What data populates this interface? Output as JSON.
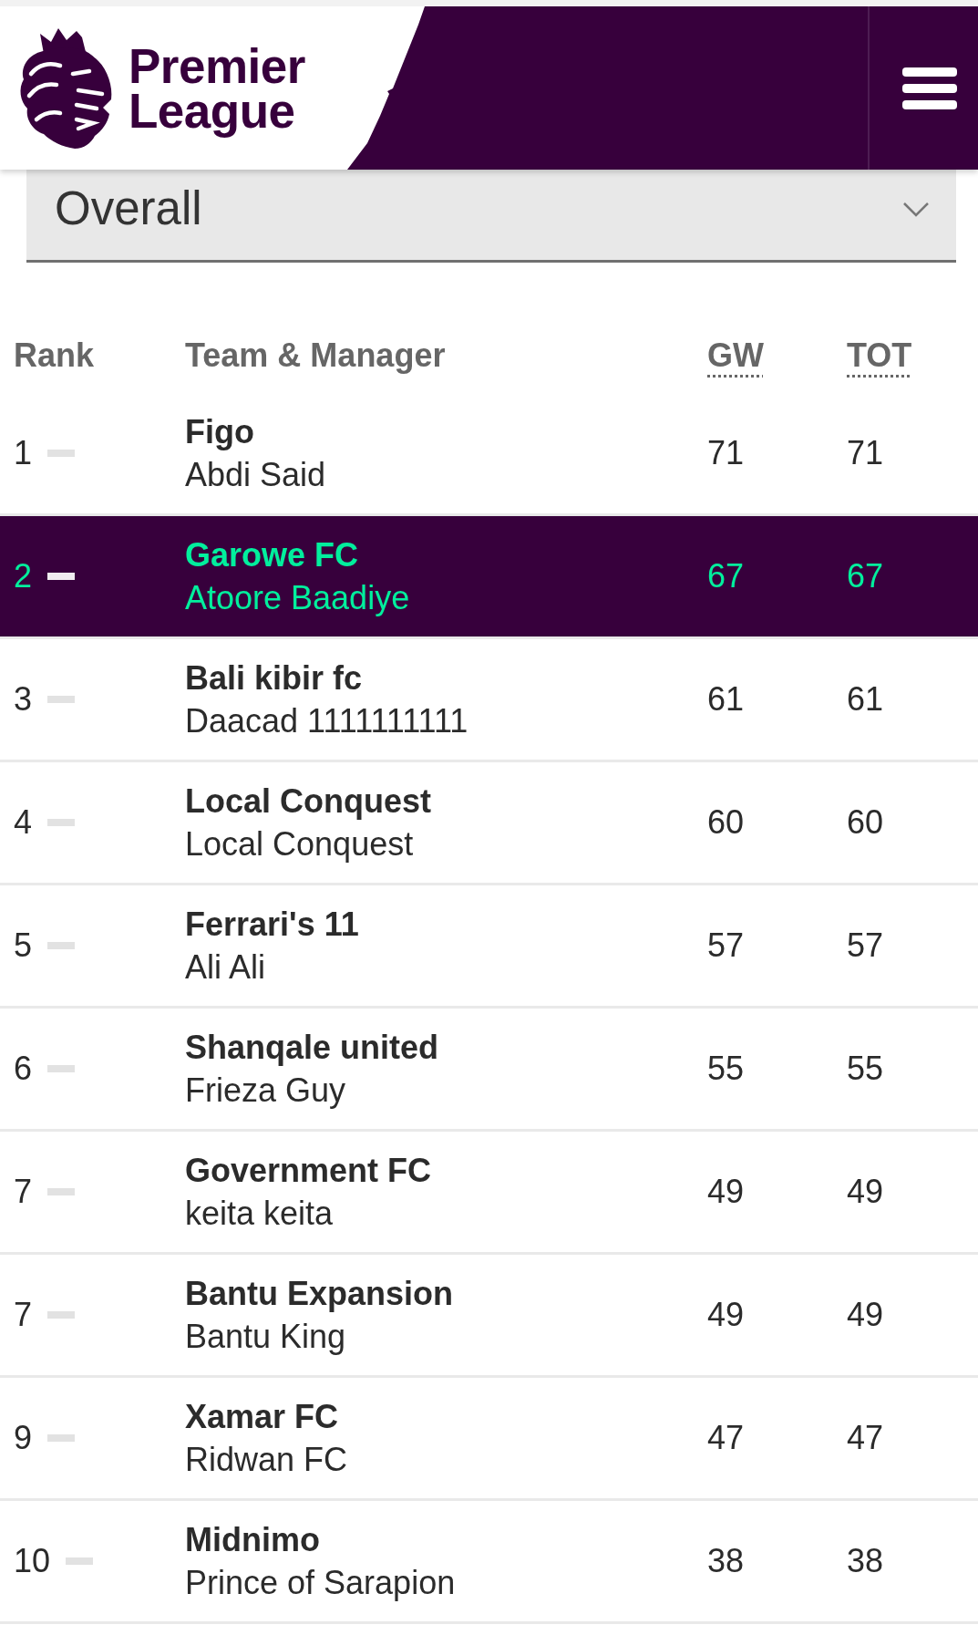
{
  "header": {
    "logo_text": "Premier League"
  },
  "filter": {
    "value": "Overall"
  },
  "table": {
    "columns": [
      {
        "label": "Rank",
        "kind": "text"
      },
      {
        "label": "Team & Manager",
        "kind": "text"
      },
      {
        "label": "GW",
        "kind": "abbreviation"
      },
      {
        "label": "TOT",
        "kind": "abbreviation"
      }
    ],
    "rows": [
      {
        "rank": "1",
        "unchanged": true,
        "team": "Figo",
        "manager": "Abdi Said",
        "gw": "71",
        "tot": "71",
        "selected": false
      },
      {
        "rank": "2",
        "unchanged": true,
        "team": "Garowe FC",
        "manager": "Atoore Baadiye",
        "gw": "67",
        "tot": "67",
        "selected": true
      },
      {
        "rank": "3",
        "unchanged": true,
        "team": "Bali kibir fc",
        "manager": "Daacad 1111111111",
        "gw": "61",
        "tot": "61",
        "selected": false
      },
      {
        "rank": "4",
        "unchanged": true,
        "team": "Local Conquest",
        "manager": "Local Conquest",
        "gw": "60",
        "tot": "60",
        "selected": false
      },
      {
        "rank": "5",
        "unchanged": true,
        "team": "Ferrari's 11",
        "manager": "Ali Ali",
        "gw": "57",
        "tot": "57",
        "selected": false
      },
      {
        "rank": "6",
        "unchanged": true,
        "team": "Shanqale united",
        "manager": "Frieza Guy",
        "gw": "55",
        "tot": "55",
        "selected": false
      },
      {
        "rank": "7",
        "unchanged": true,
        "team": "Government FC",
        "manager": "keita keita",
        "gw": "49",
        "tot": "49",
        "selected": false
      },
      {
        "rank": "7",
        "unchanged": true,
        "team": "Bantu Expansion",
        "manager": "Bantu King",
        "gw": "49",
        "tot": "49",
        "selected": false
      },
      {
        "rank": "9",
        "unchanged": true,
        "team": "Xamar FC",
        "manager": "Ridwan FC",
        "gw": "47",
        "tot": "47",
        "selected": false
      },
      {
        "rank": "10",
        "unchanged": true,
        "team": "Midnimo",
        "manager": "Prince of Sarapion",
        "gw": "38",
        "tot": "38",
        "selected": false
      }
    ]
  }
}
